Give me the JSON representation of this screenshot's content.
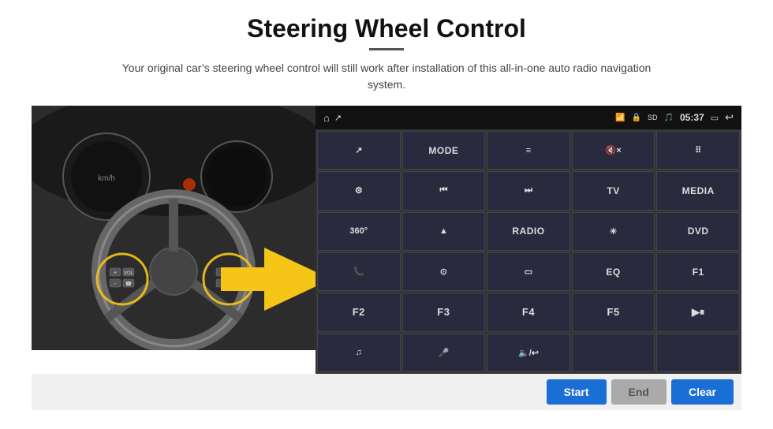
{
  "page": {
    "title": "Steering Wheel Control",
    "subtitle": "Your original car’s steering wheel control will still work after installation of this all-in-one auto radio navigation system.",
    "divider_color": "#555"
  },
  "status_bar": {
    "home_icon": "⌂",
    "wifi_icon": "WiFi",
    "lock_icon": "🔒",
    "sd_icon": "SD",
    "bt_icon": "BT",
    "time": "05:37",
    "cast_icon": "▭",
    "back_icon": "↩"
  },
  "grid_buttons": [
    {
      "label": "↗",
      "row": 1,
      "col": 1
    },
    {
      "label": "MODE",
      "row": 1,
      "col": 2
    },
    {
      "label": "≡",
      "row": 1,
      "col": 3
    },
    {
      "label": "🔇×",
      "row": 1,
      "col": 4
    },
    {
      "label": "⠿",
      "row": 1,
      "col": 5
    },
    {
      "label": "⚙",
      "row": 2,
      "col": 1
    },
    {
      "label": "⏮",
      "row": 2,
      "col": 2
    },
    {
      "label": "⏭",
      "row": 2,
      "col": 3
    },
    {
      "label": "TV",
      "row": 2,
      "col": 4
    },
    {
      "label": "MEDIA",
      "row": 2,
      "col": 5
    },
    {
      "label": "360°",
      "row": 3,
      "col": 1
    },
    {
      "label": "▲",
      "row": 3,
      "col": 2
    },
    {
      "label": "RADIO",
      "row": 3,
      "col": 3
    },
    {
      "label": "☀",
      "row": 3,
      "col": 4
    },
    {
      "label": "DVD",
      "row": 3,
      "col": 5
    },
    {
      "label": "📞",
      "row": 4,
      "col": 1
    },
    {
      "label": "⊙",
      "row": 4,
      "col": 2
    },
    {
      "label": "▭",
      "row": 4,
      "col": 3
    },
    {
      "label": "EQ",
      "row": 4,
      "col": 4
    },
    {
      "label": "F1",
      "row": 4,
      "col": 5
    },
    {
      "label": "F2",
      "row": 5,
      "col": 1
    },
    {
      "label": "F3",
      "row": 5,
      "col": 2
    },
    {
      "label": "F4",
      "row": 5,
      "col": 3
    },
    {
      "label": "F5",
      "row": 5,
      "col": 4
    },
    {
      "label": "▶⏸",
      "row": 5,
      "col": 5
    },
    {
      "label": "♫",
      "row": 6,
      "col": 1
    },
    {
      "label": "🎤",
      "row": 6,
      "col": 2
    },
    {
      "label": "🔈/↩",
      "row": 6,
      "col": 3
    },
    {
      "label": "",
      "row": 6,
      "col": 4
    },
    {
      "label": "",
      "row": 6,
      "col": 5
    }
  ],
  "action_buttons": {
    "start_label": "Start",
    "end_label": "End",
    "clear_label": "Clear"
  }
}
